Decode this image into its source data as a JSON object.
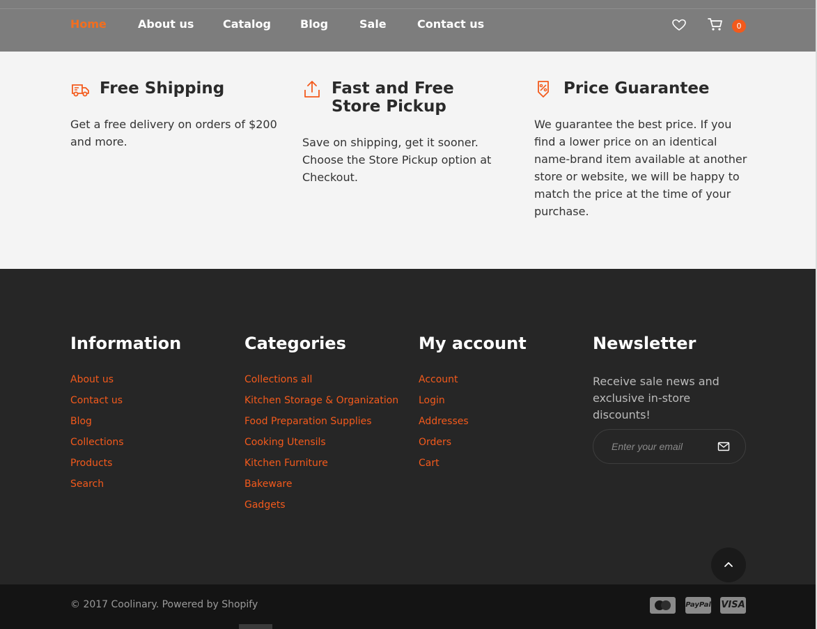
{
  "nav": {
    "items": [
      "Home",
      "About us",
      "Catalog",
      "Blog",
      "Sale",
      "Contact us"
    ],
    "active_index": 0,
    "cart_count": "0"
  },
  "features": [
    {
      "icon": "truck-icon",
      "title": "Free Shipping",
      "text": "Get a free delivery on orders of $200 and more."
    },
    {
      "icon": "upload-icon",
      "title": "Fast and Free Store Pickup",
      "text": "Save on shipping, get it sooner. Choose the Store Pickup option at Checkout."
    },
    {
      "icon": "price-tag-icon",
      "title": "Price Guarantee",
      "text": "We guarantee the best price. If you find a lower price on an identical name-brand item available at another store or website, we will be happy to match the price at the time of your purchase."
    }
  ],
  "footer": {
    "information": {
      "title": "Information",
      "links": [
        "About us",
        "Contact us",
        "Blog",
        "Collections",
        "Products",
        "Search"
      ]
    },
    "categories": {
      "title": "Categories",
      "links": [
        "Collections all",
        "Kitchen Storage & Organization",
        "Food Preparation Supplies",
        "Cooking Utensils",
        "Kitchen Furniture",
        "Bakeware",
        "Gadgets"
      ]
    },
    "account": {
      "title": "My account",
      "links": [
        "Account",
        "Login",
        "Addresses",
        "Orders",
        "Cart"
      ]
    },
    "newsletter": {
      "title": "Newsletter",
      "text": "Receive sale news and exclusive in-store discounts!",
      "placeholder": "Enter your email"
    }
  },
  "bottom": {
    "copyright": "© 2017 Coolinary. Powered by Shopify",
    "payments": [
      "MasterCard",
      "PayPal",
      "VISA"
    ]
  },
  "colors": {
    "accent": "#f35a1c",
    "header_bg": "#7d7d7d",
    "footer_bg": "#262626",
    "bottom_bg": "#141414"
  }
}
